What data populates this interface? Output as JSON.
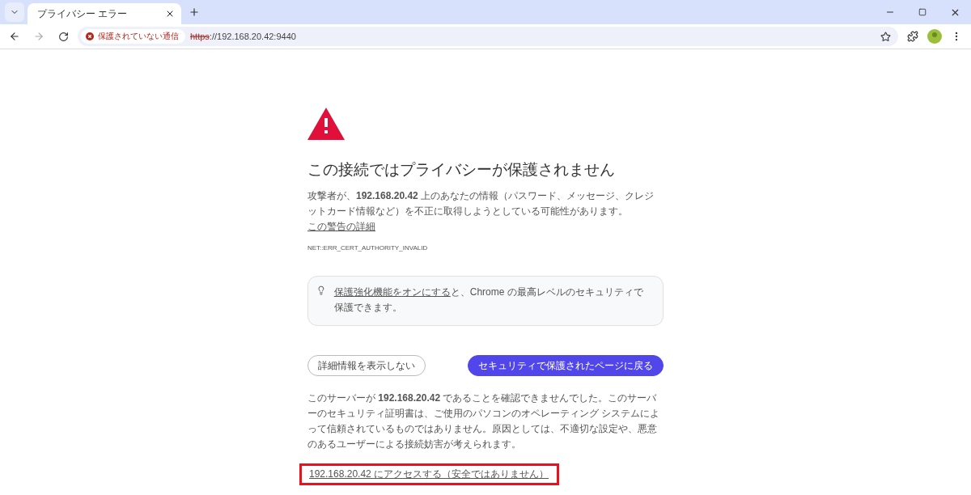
{
  "tabs": [
    {
      "title": "プライバシー エラー",
      "selected": true
    }
  ],
  "omnibox": {
    "security_chip": "保護されていない通信",
    "scheme": "https",
    "rest": "://192.168.20.42:9440",
    "scheme_struck": true
  },
  "page": {
    "heading": "この接続ではプライバシーが保護されません",
    "description": {
      "text": "攻撃者が、**192.168.20.42** 上のあなたの情報（パスワード、メッセージ、クレジットカード情報など）を不正に取得しようとしている可能性があります。",
      "link": "この警告の詳細"
    },
    "error_code": "NET::ERR_CERT_AUTHORITY_INVALID",
    "tip": {
      "link": "保護強化機能をオンにする",
      "text": "と、Chrome の最高レベルのセキュリティで保護できます。"
    },
    "buttons": [
      {
        "label": "詳細情報を表示しない",
        "kind": "secondary"
      },
      {
        "label": "セキュリティで保護されたページに戻る",
        "kind": "primary"
      }
    ],
    "details": "このサーバーが **192.168.20.42** であることを確認できませんでした。このサーバーのセキュリティ証明書は、ご使用のパソコンのオペレーティング システムによって信頼されているものではありません。原因としては、不適切な設定や、悪意のあるユーザーによる接続妨害が考えられます。",
    "proceed_link": {
      "text": "192.168.20.42 にアクセスする（安全ではありません）",
      "highlighted": true
    }
  }
}
